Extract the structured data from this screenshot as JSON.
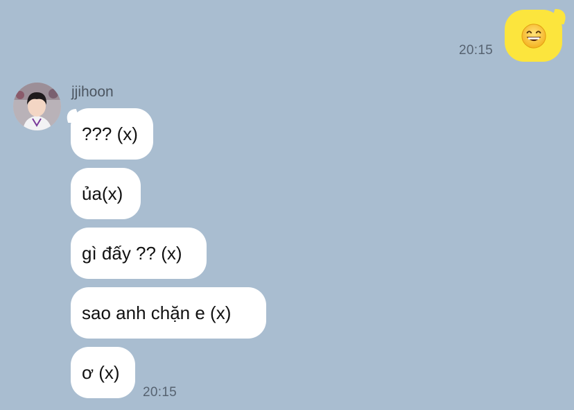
{
  "conversation": {
    "sent": {
      "emoji": "grinning-face-with-smiling-eyes",
      "time": "20:15"
    },
    "received": {
      "sender_name": "jjihoon",
      "avatar": "profile-photo",
      "time": "20:15",
      "messages": [
        {
          "text": "??? (x)"
        },
        {
          "text": "ủa(x)"
        },
        {
          "text": "gì đấy ?? (x)"
        },
        {
          "text": "sao anh chặn e (x)"
        },
        {
          "text": "ơ (x)"
        }
      ]
    }
  },
  "colors": {
    "background": "#a9bdd0",
    "sent_bubble": "#fce53d",
    "received_bubble": "#ffffff",
    "timestamp": "#566270"
  }
}
